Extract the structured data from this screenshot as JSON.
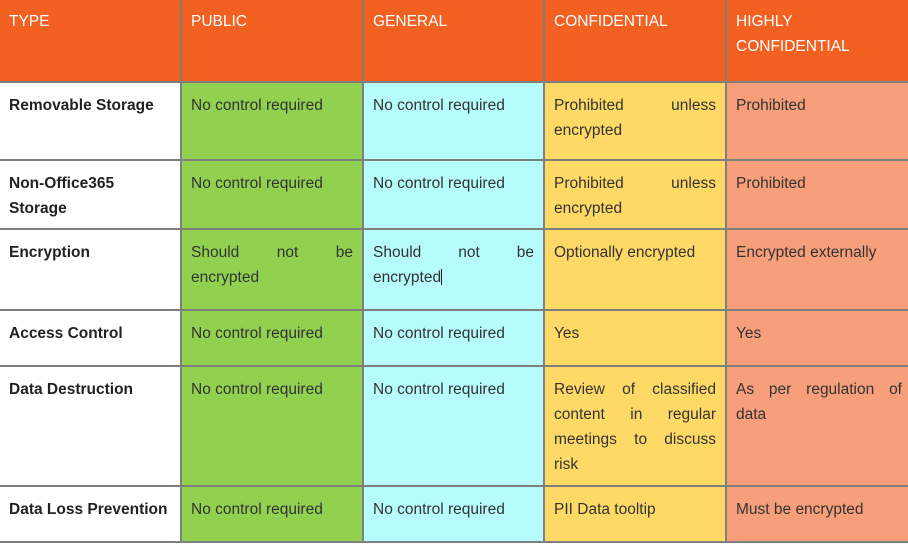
{
  "table": {
    "headers": [
      "TYPE",
      "PUBLIC",
      "GENERAL",
      "CONFIDENTIAL",
      "HIGHLY CONFIDENTIAL"
    ],
    "colors": {
      "header": "#f26122",
      "public": "#92d050",
      "general": "#b6fcfc",
      "confidential": "#ffd966",
      "highly_confidential": "#f79e7a"
    },
    "rows": [
      {
        "type": "Removable Storage",
        "public": "No control required",
        "general": "No control required",
        "confidential": "Prohibited unless encrypted",
        "highly": "Prohibited"
      },
      {
        "type": "Non-Office365 Storage",
        "public": "No control required",
        "general": "No control required",
        "confidential": "Prohibited unless encrypted",
        "highly": "Prohibited"
      },
      {
        "type": "Encryption",
        "public": "Should not be encrypted",
        "general": "Should not be encrypted",
        "confidential": "Optionally encrypted",
        "highly": "Encrypted externally"
      },
      {
        "type": "Access Control",
        "public": "No control required",
        "general": "No control required",
        "confidential": "Yes",
        "highly": "Yes"
      },
      {
        "type": "Data Destruction",
        "public": "No control required",
        "general": "No control required",
        "confidential": "Review of classified content in regular meetings to discuss risk",
        "highly": "As per regulation of data"
      },
      {
        "type": "Data Loss Prevention",
        "public": "No control required",
        "general": "No control required",
        "confidential": "PII Data tooltip",
        "highly": "Must be encrypted"
      }
    ]
  }
}
